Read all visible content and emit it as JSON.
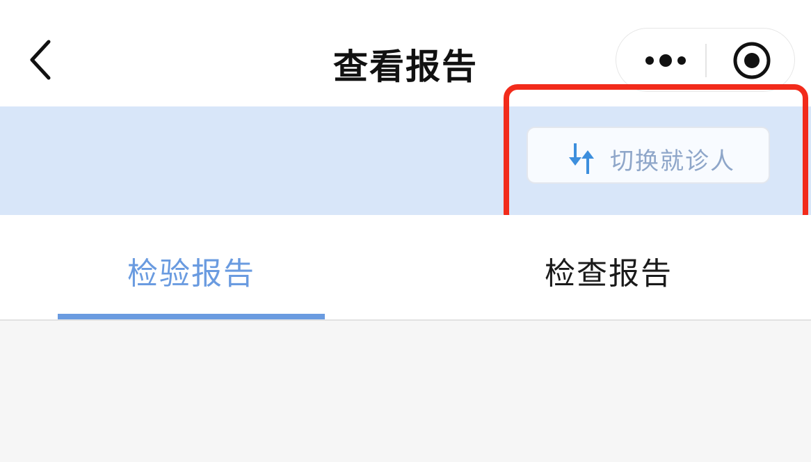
{
  "navbar": {
    "title": "查看报告",
    "back_icon": "chevron-left-icon",
    "more_icon": "more-dots-icon",
    "close_icon": "target-circle-icon"
  },
  "patient_bar": {
    "switch_button_label": "切换就诊人",
    "switch_icon": "swap-vertical-arrows-icon",
    "background_color": "#d8e6f9"
  },
  "tabs": {
    "items": [
      {
        "label": "检验报告",
        "active": true
      },
      {
        "label": "检查报告",
        "active": false
      }
    ],
    "active_color": "#6a9be0"
  },
  "highlight": {
    "color": "#f22b1b"
  }
}
